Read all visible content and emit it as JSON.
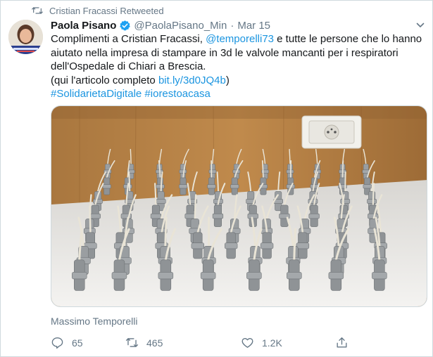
{
  "retweet_context": {
    "text": "Cristian Fracassi Retweeted"
  },
  "author": {
    "display_name": "Paola Pisano",
    "handle": "@PaolaPisano_Min",
    "date": "Mar 15",
    "separator": "·"
  },
  "tweet": {
    "line1_a": "Complimenti a Cristian Fracassi, ",
    "mention": "@temporelli73",
    "line1_b": "  e tutte le persone che lo hanno aiutato nella impresa di stampare in 3d le valvole mancanti per i respiratori dell'Ospedale di Chiari a Brescia.",
    "line2_a": "(qui l'articolo completo ",
    "link": "bit.ly/3d0JQ4b",
    "line2_b": ")",
    "hashtag1": "#SolidarietaDigitale",
    "hashtag2": "#iorestoacasa"
  },
  "media": {
    "credit": "Massimo Temporelli"
  },
  "actions": {
    "replies": "65",
    "retweets": "465",
    "likes": "1.2K"
  },
  "colors": {
    "link": "#1b95e0",
    "muted": "#657786",
    "verified": "#1da1f2",
    "text": "#14171a"
  }
}
